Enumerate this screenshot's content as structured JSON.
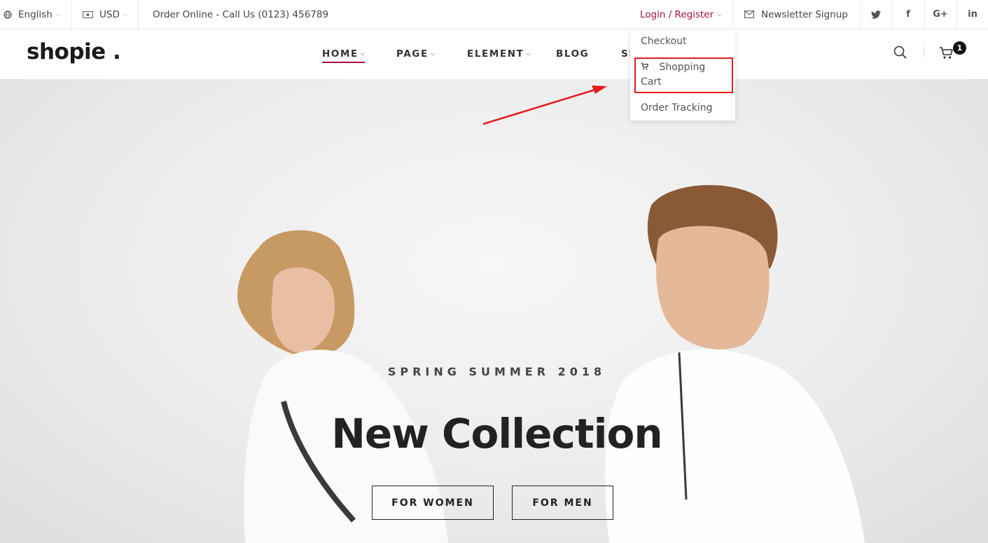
{
  "topbar": {
    "language": "English",
    "currency": "USD",
    "order_text": "Order Online - Call Us (0123) 456789",
    "login": "Login / Register",
    "newsletter": "Newsletter Signup",
    "social": [
      "twitter-icon",
      "facebook-icon",
      "google-plus-icon",
      "linkedin-icon"
    ],
    "social_glyphs": [
      "t",
      "f",
      "G+",
      "in"
    ]
  },
  "header": {
    "logo": "shopie .",
    "nav": [
      {
        "label": "HOME",
        "has_caret": true,
        "active": true
      },
      {
        "label": "PAGE",
        "has_caret": true
      },
      {
        "label": "ELEMENT",
        "has_caret": true
      },
      {
        "label": "BLOG",
        "has_caret": false
      },
      {
        "label": "SH",
        "has_caret": false
      }
    ],
    "cart_count": "1"
  },
  "dropdown": {
    "items": [
      "Checkout",
      "Shopping",
      "Cart",
      "Order Tracking"
    ]
  },
  "hero": {
    "subtitle": "SPRING SUMMER 2018",
    "title": "New Collection",
    "btn_women": "FOR WOMEN",
    "btn_men": "FOR MEN"
  },
  "colors": {
    "accent": "#a4123f",
    "annotation": "#e41c1c"
  }
}
